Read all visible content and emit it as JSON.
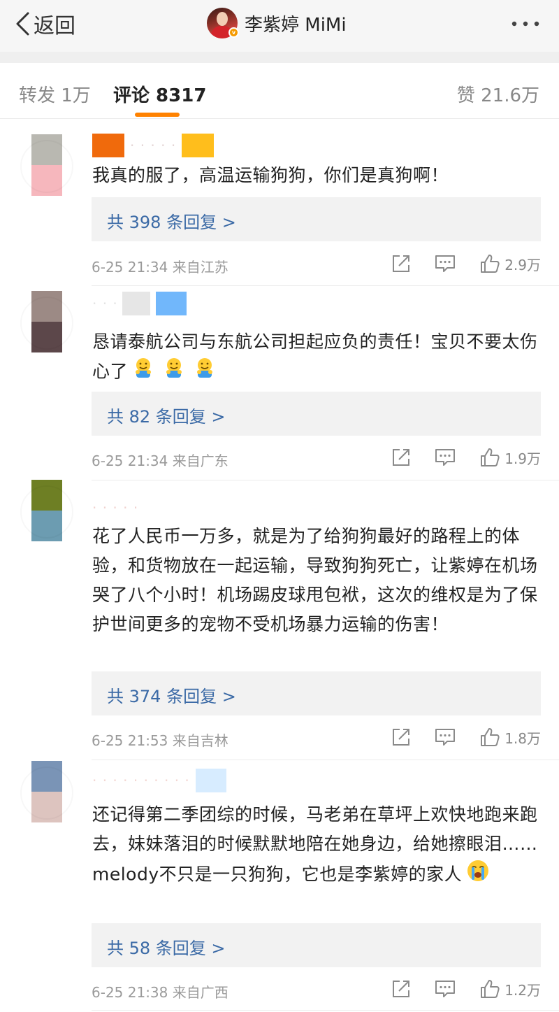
{
  "nav": {
    "back_label": "返回",
    "title": "李紫婷 MiMi",
    "verified_mark": "v"
  },
  "tabs": [
    {
      "label": "转发 1万"
    },
    {
      "label": "评论 8317"
    },
    {
      "label": "赞 21.6万"
    }
  ],
  "colors": {
    "accent": "#ff8200",
    "reply_link": "#3b6aa6",
    "meta_gray": "#9a9a9a",
    "reply_bg": "#f2f2f2"
  },
  "comments": [
    {
      "text": "我真的服了，高温运输狗狗，你们是真狗啊！",
      "reply_label": "共 398 条回复 >",
      "time": "6-25 21:34",
      "source": "来自江苏",
      "likes": "2.9万"
    },
    {
      "text": "恳请泰航公司与东航公司担起应负的责任！宝贝不要太伤心了",
      "emojis": [
        "hug-emoji",
        "hug-emoji",
        "hug-emoji"
      ],
      "reply_label": "共 82 条回复 >",
      "time": "6-25 21:34",
      "source": "来自广东",
      "likes": "1.9万"
    },
    {
      "text": "花了人民币一万多，就是为了给狗狗最好的路程上的体验，和货物放在一起运输，导致狗狗死亡，让紫婷在机场哭了八个小时！机场踢皮球甩包袱，这次的维权是为了保护世间更多的宠物不受机场暴力运输的伤害！",
      "reply_label": "共 374 条回复 >",
      "time": "6-25 21:53",
      "source": "来自吉林",
      "likes": "1.8万"
    },
    {
      "text": "还记得第二季团综的时候，马老弟在草坪上欢快地跑来跑去，妹妹落泪的时候默默地陪在她身边，给她擦眼泪……melody不只是一只狗狗，它也是李紫婷的家人",
      "emojis": [
        "crying-emoji"
      ],
      "reply_label": "共 58 条回复 >",
      "time": "6-25 21:38",
      "source": "来自广西",
      "likes": "1.2万"
    }
  ]
}
